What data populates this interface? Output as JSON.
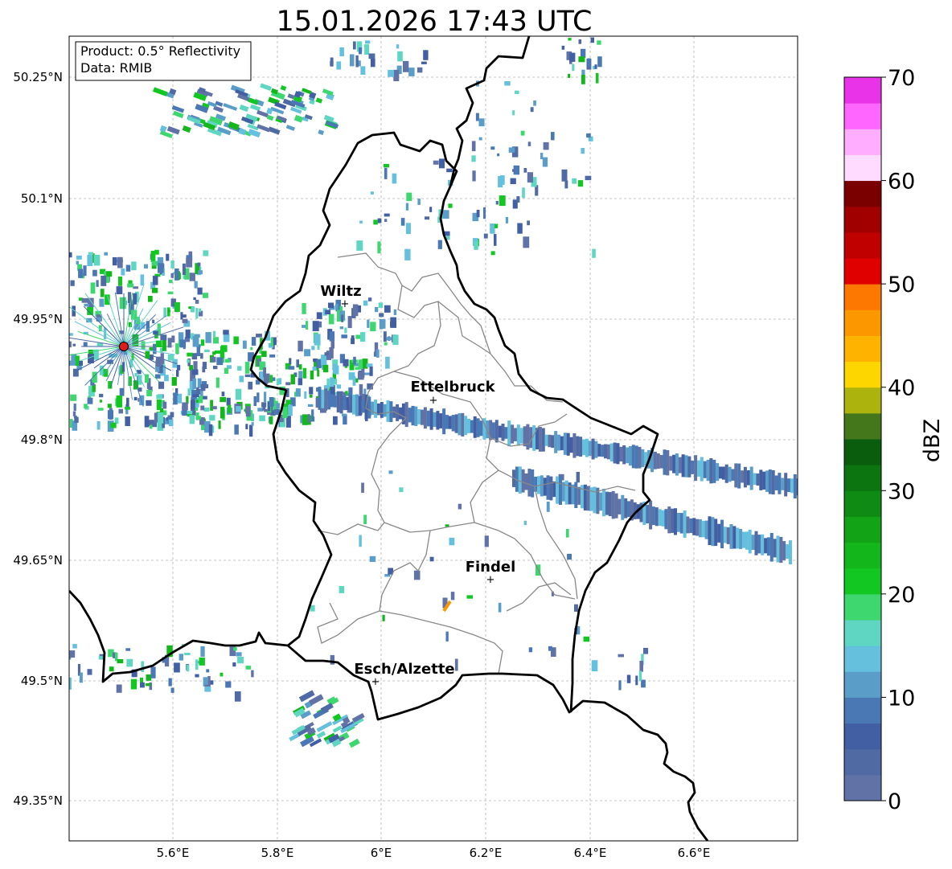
{
  "title": "15.01.2026 17:43 UTC",
  "info": {
    "product": "Product: 0.5° Reflectivity",
    "data_source": "Data: RMIB"
  },
  "axes": {
    "lat_ticks": [
      "50.25°N",
      "50.1°N",
      "49.95°N",
      "49.8°N",
      "49.65°N",
      "49.5°N",
      "49.35°N"
    ],
    "lon_ticks": [
      "5.6°E",
      "5.8°E",
      "6°E",
      "6.2°E",
      "6.4°E",
      "6.6°E"
    ],
    "grid": true
  },
  "cities": [
    {
      "name": "Wiltz"
    },
    {
      "name": "Ettelbruck"
    },
    {
      "name": "Findel"
    },
    {
      "name": "Esch/Alzette"
    }
  ],
  "colorbar": {
    "label": "dBZ",
    "ticks": [
      "0",
      "10",
      "20",
      "30",
      "40",
      "50",
      "60",
      "70"
    ],
    "colors": [
      "#6173a6",
      "#506aa3",
      "#425fa3",
      "#4a78b4",
      "#5a9dc8",
      "#64c0dc",
      "#5ed6c2",
      "#3ed76f",
      "#12c722",
      "#13b61b",
      "#13a316",
      "#0f8a13",
      "#0c7510",
      "#0a5d0d",
      "#44761b",
      "#acb30d",
      "#fdd600",
      "#fdb300",
      "#fd9700",
      "#fd7800",
      "#e10000",
      "#c00000",
      "#a00000",
      "#7a0000",
      "#ffdcff",
      "#ffaeff",
      "#ff66ff",
      "#e833e8"
    ],
    "min": 0,
    "max": 70
  },
  "radar_site_color": "#e31a1c"
}
